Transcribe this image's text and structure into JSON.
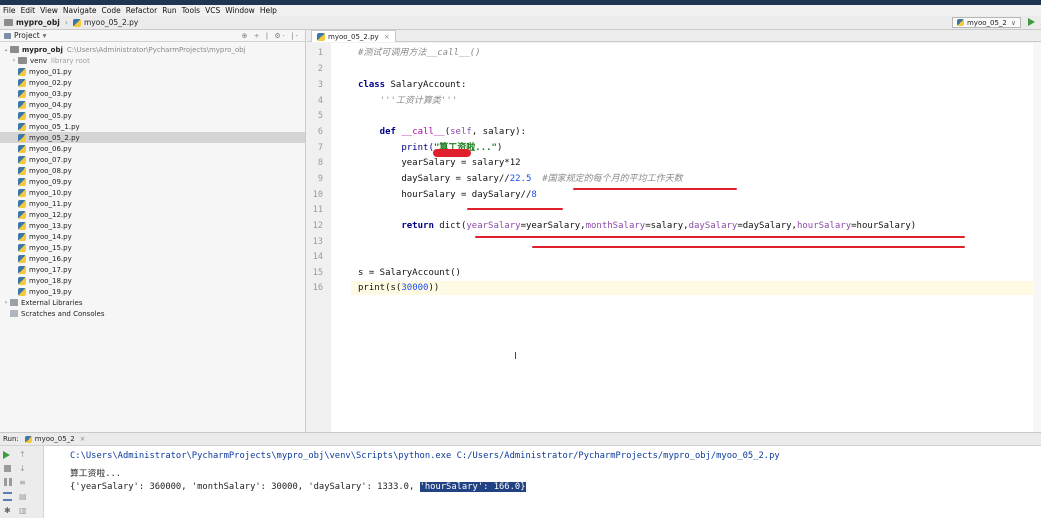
{
  "menu": [
    "File",
    "Edit",
    "View",
    "Navigate",
    "Code",
    "Refactor",
    "Run",
    "Tools",
    "VCS",
    "Window",
    "Help"
  ],
  "nav": {
    "project": "mypro_obj",
    "file": "myoo_05_2.py",
    "run_config": "myoo_05_2",
    "run_config_arrow": "∨"
  },
  "project_panel": {
    "title": "Project",
    "title_arrow": "▾",
    "tools": "⊕ ÷ | ⚙· |-",
    "root_name": "mypro_obj",
    "root_path": "C:\\Users\\Administrator\\PycharmProjects\\mypro_obj",
    "venv": "venv",
    "venv_note": "library root",
    "files": [
      "myoo_01.py",
      "myoo_02.py",
      "myoo_03.py",
      "myoo_04.py",
      "myoo_05.py",
      "myoo_05_1.py",
      "myoo_05_2.py",
      "myoo_06.py",
      "myoo_07.py",
      "myoo_08.py",
      "myoo_09.py",
      "myoo_10.py",
      "myoo_11.py",
      "myoo_12.py",
      "myoo_13.py",
      "myoo_14.py",
      "myoo_15.py",
      "myoo_16.py",
      "myoo_17.py",
      "myoo_18.py",
      "myoo_19.py"
    ],
    "selected_file": "myoo_05_2.py",
    "external_libraries": "External Libraries",
    "scratches": "Scratches and Consoles"
  },
  "editor": {
    "tab_label": "myoo_05_2.py",
    "tab_close": "×",
    "line_numbers": [
      "1",
      "2",
      "3",
      "4",
      "5",
      "6",
      "7",
      "8",
      "9",
      "10",
      "11",
      "12",
      "13",
      "14",
      "15",
      "16"
    ],
    "lines": {
      "l1": "#测试可调用方法__call__()",
      "l3_kw": "class",
      "l3_rest": " SalaryAccount:",
      "l4": "    '''工资计算类'''",
      "l6_kw": "    def",
      "l6_name": "__call__",
      "l6_self": "self",
      "l6_rest": ", salary):",
      "l7_fn": "        print(",
      "l7_str": "\"算工资啦...\"",
      "l7_end": ")",
      "l8": "        yearSalary = salary*12",
      "l9_a": "        daySalary = salary//",
      "l9_num": "22.5",
      "l9_comment": "  #国家规定的每个月的平均工作天数",
      "l10_a": "        hourSalary = daySalary//",
      "l10_num": "8",
      "l12_kw": "        return",
      "l12_fn": " dict(",
      "l12_k1": "yearSalary",
      "l12_v1": "=yearSalary,",
      "l12_k2": "monthSalary",
      "l12_v2": "=salary,",
      "l12_k3": "daySalary",
      "l12_v3": "=daySalary,",
      "l12_k4": "hourSalary",
      "l12_v4": "=hourSalary)",
      "l15": "s = SalaryAccount()",
      "l16_a": "print(s(",
      "l16_num": "30000",
      "l16_b": "))"
    }
  },
  "run": {
    "label": "Run:",
    "config": "myoo_05_2",
    "close": "×",
    "command": "C:\\Users\\Administrator\\PycharmProjects\\mypro_obj\\venv\\Scripts\\python.exe C:/Users/Administrator/PycharmProjects/mypro_obj/myoo_05_2.py",
    "output_line1": "算工资啦...",
    "output_line2_pre": "{'yearSalary': 360000, 'monthSalary': 30000, 'daySalary': 1333.0, ",
    "output_line2_hl": "'hourSalary': 166.0}"
  },
  "colors": {
    "annotation_red": "#e0202c",
    "selection": "#214283"
  }
}
